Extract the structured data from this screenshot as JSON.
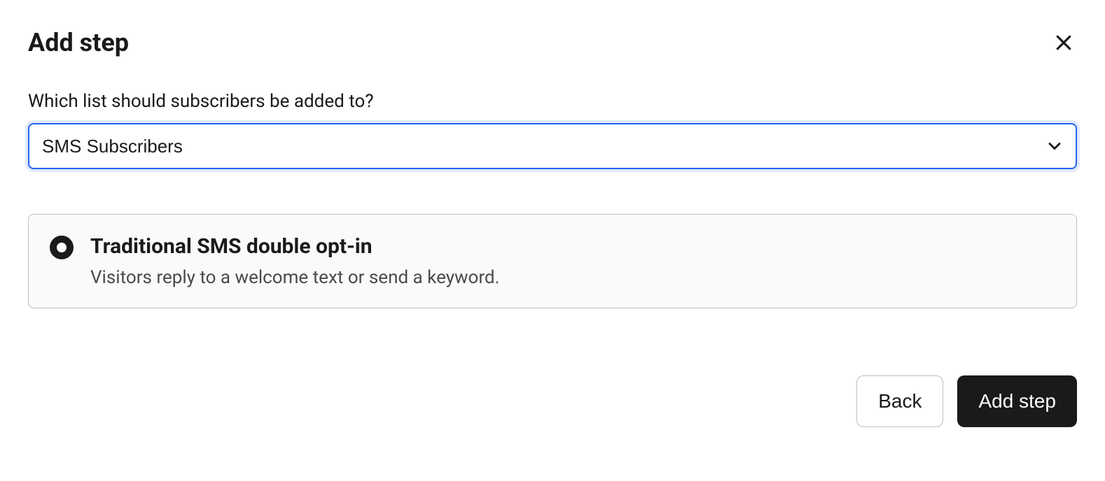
{
  "header": {
    "title": "Add step"
  },
  "form": {
    "list_label": "Which list should subscribers be added to?",
    "list_selected": "SMS Subscribers"
  },
  "option": {
    "title": "Traditional SMS double opt-in",
    "description": "Visitors reply to a welcome text or send a keyword."
  },
  "footer": {
    "back_label": "Back",
    "add_label": "Add step"
  }
}
